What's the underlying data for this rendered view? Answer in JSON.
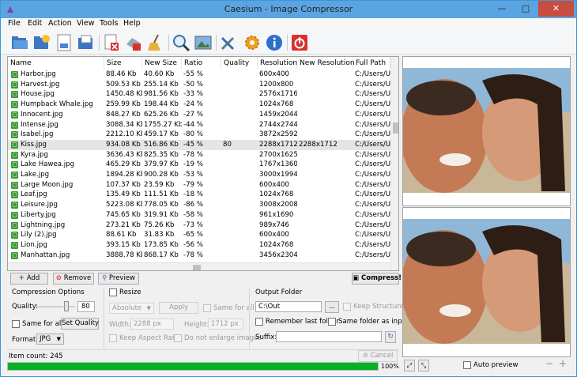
{
  "window": {
    "title": "Caesium - Image Compressor",
    "minimize": "—",
    "maximize": "□",
    "close": "✕"
  },
  "menu": [
    "File",
    "Edit",
    "Action",
    "View",
    "Tools",
    "Help"
  ],
  "toolbar_icons": [
    "open-folder-icon",
    "add-folder-icon",
    "save-icon",
    "export-icon",
    "remove-item-icon",
    "clear-list-icon",
    "broom-icon",
    "search-icon",
    "preview-image-icon",
    "tools-icon",
    "settings-icon",
    "info-icon",
    "power-icon"
  ],
  "list": {
    "columns": [
      "Name",
      "Size",
      "New Size",
      "Ratio",
      "Quality",
      "Resolution",
      "New Resolution",
      "Full Path"
    ],
    "selected_index": 7,
    "rows": [
      [
        "Harbor.jpg",
        "88.46 Kb",
        "40.60 Kb",
        "-55 %",
        "",
        "600x400",
        "",
        "C:/Users/Use"
      ],
      [
        "Harvest.jpg",
        "509.53 Kb",
        "255.14 Kb",
        "-50 %",
        "",
        "1200x800",
        "",
        "C:/Users/Use"
      ],
      [
        "House.jpg",
        "1450.48 Kb",
        "981.56 Kb",
        "-33 %",
        "",
        "2576x1716",
        "",
        "C:/Users/Use"
      ],
      [
        "Humpback Whale.jpg",
        "259.99 Kb",
        "198.44 Kb",
        "-24 %",
        "",
        "1024x768",
        "",
        "C:/Users/Use"
      ],
      [
        "Innocent.jpg",
        "848.27 Kb",
        "625.26 Kb",
        "-27 %",
        "",
        "1459x2044",
        "",
        "C:/Users/Use"
      ],
      [
        "Intense.jpg",
        "3088.34 Kb",
        "1755.27 Kb",
        "-44 %",
        "",
        "2744x2744",
        "",
        "C:/Users/Use"
      ],
      [
        "Isabel.jpg",
        "2212.10 Kb",
        "459.17 Kb",
        "-80 %",
        "",
        "3872x2592",
        "",
        "C:/Users/Use"
      ],
      [
        "Kiss.jpg",
        "934.08 Kb",
        "516.86 Kb",
        "-45 %",
        "80",
        "2288x1712",
        "2288x1712",
        "C:/Users/Use"
      ],
      [
        "Kyra.jpg",
        "3636.43 Kb",
        "825.35 Kb",
        "-78 %",
        "",
        "2700x1625",
        "",
        "C:/Users/Use"
      ],
      [
        "Lake Hawea.jpg",
        "465.29 Kb",
        "379.97 Kb",
        "-19 %",
        "",
        "1767x1360",
        "",
        "C:/Users/Use"
      ],
      [
        "Lake.jpg",
        "1894.28 Kb",
        "900.28 Kb",
        "-53 %",
        "",
        "3000x1994",
        "",
        "C:/Users/Use"
      ],
      [
        "Large Moon.jpg",
        "107.37 Kb",
        "23.59 Kb",
        "-79 %",
        "",
        "600x400",
        "",
        "C:/Users/Use"
      ],
      [
        "Leaf.jpg",
        "135.49 Kb",
        "111.51 Kb",
        "-18 %",
        "",
        "1024x768",
        "",
        "C:/Users/Use"
      ],
      [
        "Leisure.jpg",
        "5223.08 Kb",
        "778.05 Kb",
        "-86 %",
        "",
        "3008x2008",
        "",
        "C:/Users/Use"
      ],
      [
        "Liberty.jpg",
        "745.65 Kb",
        "319.91 Kb",
        "-58 %",
        "",
        "961x1690",
        "",
        "C:/Users/Use"
      ],
      [
        "Lightning.jpg",
        "273.21 Kb",
        "75.26 Kb",
        "-73 %",
        "",
        "989x746",
        "",
        "C:/Users/Use"
      ],
      [
        "Lily (2).jpg",
        "88.61 Kb",
        "31.83 Kb",
        "-65 %",
        "",
        "600x400",
        "",
        "C:/Users/Use"
      ],
      [
        "Lion.jpg",
        "393.15 Kb",
        "173.85 Kb",
        "-56 %",
        "",
        "1024x768",
        "",
        "C:/Users/Use"
      ],
      [
        "Manhattan.jpg",
        "3888.78 Kb",
        "868.17 Kb",
        "-78 %",
        "",
        "3456x2304",
        "",
        "C:/Users/Use"
      ]
    ]
  },
  "actions": {
    "add": "Add",
    "remove": "Remove",
    "preview": "Preview",
    "compress": "Compress!"
  },
  "compression": {
    "title": "Compression Options",
    "quality_label": "Quality:",
    "quality_value": "80",
    "quality_percent": 80,
    "same_for_all": "Same for all",
    "set_quality": "Set Quality",
    "format_label": "Format:",
    "format_value": "JPG"
  },
  "resize": {
    "title": "Resize",
    "mode": "Absolute",
    "apply": "Apply",
    "same_for_all": "Same for all",
    "width_label": "Width:",
    "width_value": "2288 px",
    "height_label": "Height:",
    "height_value": "1712 px",
    "keep_aspect": "Keep Aspect Ratio",
    "no_enlarge": "Do not enlarge images"
  },
  "output": {
    "title": "Output Folder",
    "path": "C:\\Out",
    "browse": "...",
    "keep_structure": "Keep Structure",
    "remember": "Remember last folder",
    "same_folder": "Same folder as input",
    "suffix_label": "Suffix:",
    "suffix_value": ""
  },
  "status": {
    "item_count": "Item count: 245",
    "cancel": "Cancel",
    "progress_text": "100%",
    "progress_value": 100
  },
  "preview": {
    "auto_preview": "Auto preview",
    "zoom_out": "−",
    "zoom_in": "+"
  }
}
